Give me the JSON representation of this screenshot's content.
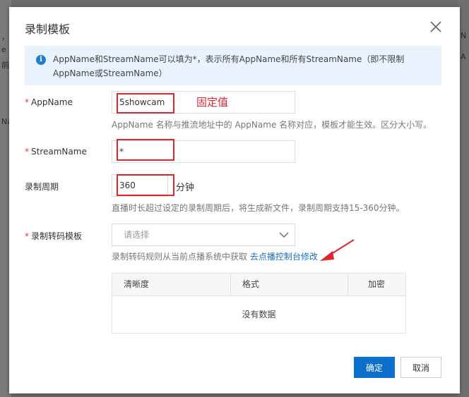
{
  "backdrop": {
    "left_fragments": [
      "，",
      "e",
      "前",
      "Na"
    ],
    "right_fragments": [
      "N",
      "A"
    ]
  },
  "dialog": {
    "title": "录制模板",
    "notice": "AppName和StreamName可以填为*，表示所有AppName和所有StreamName（即不限制AppName或StreamName）",
    "required_mark": "*",
    "fields": {
      "app_name": {
        "label": "AppName",
        "value": "5showcam",
        "hint": "AppName 名称与推流地址中的 AppName 名称对应，模板才能生效。区分大小写。"
      },
      "stream_name": {
        "label": "StreamName",
        "value": "*"
      },
      "period": {
        "label": "录制周期",
        "value": "360",
        "unit": "分钟",
        "hint": "直播时长超过设定的录制周期后，将生成新文件，录制周期支持15-360分钟。"
      },
      "transcode": {
        "label": "录制转码模板",
        "placeholder": "请选择",
        "hint_prefix": "录制转码规则从当前点播系统中获取",
        "hint_link": "去点播控制台修改"
      }
    },
    "table": {
      "columns": [
        "清晰度",
        "格式",
        "加密"
      ],
      "empty_text": "没有数据"
    },
    "buttons": {
      "confirm": "确定",
      "cancel": "取消"
    }
  },
  "annotations": {
    "fixed_value_note": "固定值",
    "color": "#e0262c"
  },
  "colors": {
    "primary": "#0c6fcb",
    "notice_bg": "#e8f3fd",
    "link": "#1b6fc5"
  }
}
